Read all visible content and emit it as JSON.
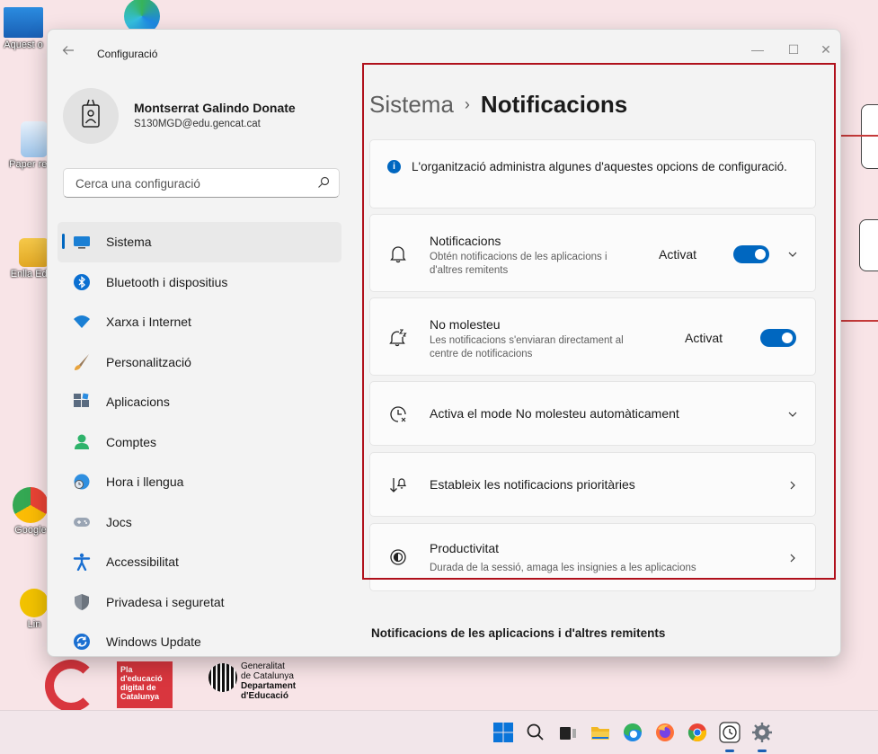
{
  "desktop": {
    "icons": [
      {
        "label": "Aquest o"
      },
      {
        "label": "Paper recic"
      },
      {
        "label": "Enlla Educ"
      },
      {
        "label": "Google"
      },
      {
        "label": "Lin"
      }
    ],
    "logos": {
      "pla": [
        "Pla",
        "d'educació",
        "digital de",
        "Catalunya"
      ],
      "generalitat": [
        "Generalitat",
        "de Catalunya",
        "Departament",
        "d'Educació"
      ]
    }
  },
  "window": {
    "title": "Configuració",
    "controls": {
      "minimize": "—",
      "maximize": "☐",
      "close": "✕"
    }
  },
  "profile": {
    "name": "Montserrat Galindo Donate",
    "email": "S130MGD@edu.gencat.cat"
  },
  "search": {
    "placeholder": "Cerca una configuració"
  },
  "nav": {
    "items": [
      {
        "label": "Sistema",
        "icon": "system-icon",
        "active": true
      },
      {
        "label": "Bluetooth i dispositius",
        "icon": "bluetooth-icon"
      },
      {
        "label": "Xarxa i Internet",
        "icon": "wifi-icon"
      },
      {
        "label": "Personalització",
        "icon": "brush-icon"
      },
      {
        "label": "Aplicacions",
        "icon": "apps-icon"
      },
      {
        "label": "Comptes",
        "icon": "person-icon"
      },
      {
        "label": "Hora i llengua",
        "icon": "globe-clock-icon"
      },
      {
        "label": "Jocs",
        "icon": "gamepad-icon"
      },
      {
        "label": "Accessibilitat",
        "icon": "accessibility-icon"
      },
      {
        "label": "Privadesa i seguretat",
        "icon": "shield-icon"
      },
      {
        "label": "Windows Update",
        "icon": "update-icon"
      }
    ]
  },
  "main": {
    "breadcrumb": {
      "parent": "Sistema",
      "separator": "›",
      "current": "Notificacions"
    },
    "info": "L'organització administra algunes d'aquestes opcions de configuració.",
    "notifications": {
      "title": "Notificacions",
      "subtitle_1": "Obtén notificacions de les aplicacions i",
      "subtitle_2": "d'altres remitents",
      "state": "Activat",
      "on": true
    },
    "dnd": {
      "title": "No molesteu",
      "subtitle_1": "Les notificacions s'enviaran directament al",
      "subtitle_2": "centre de notificacions",
      "state": "Activat",
      "on": true
    },
    "auto_dnd": {
      "title": "Activa el mode No molesteu automàticament"
    },
    "priority": {
      "title": "Estableix les notificacions prioritàries"
    },
    "productivity": {
      "title": "Productivitat",
      "subtitle": "Durada de la sessió, amaga les insignies a les aplicacions"
    },
    "section_heading": "Notificacions de les aplicacions i d'altres remitents"
  },
  "taskbar": {
    "icons": [
      "windows-start-icon",
      "search-icon",
      "task-view-icon",
      "file-explorer-icon",
      "edge-icon",
      "firefox-icon",
      "chrome-icon",
      "clock-app-icon",
      "settings-icon"
    ]
  },
  "colors": {
    "accent": "#0067c0",
    "highlight": "#b0101b",
    "brand_red": "#d9363e"
  }
}
